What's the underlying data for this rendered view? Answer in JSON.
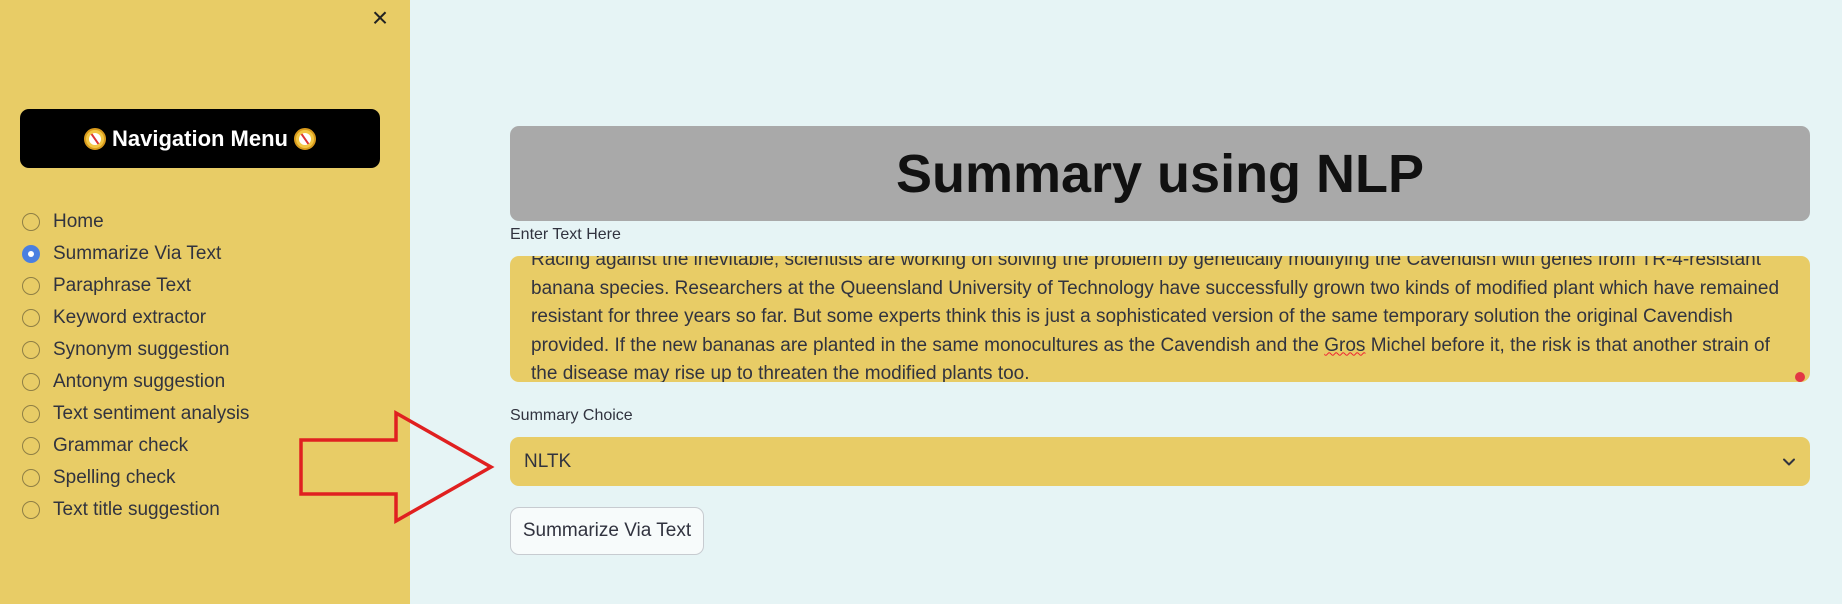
{
  "sidebar": {
    "close_icon": "×",
    "nav_title": "Navigation Menu",
    "items": [
      {
        "label": "Home",
        "selected": false
      },
      {
        "label": "Summarize Via Text",
        "selected": true
      },
      {
        "label": "Paraphrase Text",
        "selected": false
      },
      {
        "label": "Keyword extractor",
        "selected": false
      },
      {
        "label": "Synonym suggestion",
        "selected": false
      },
      {
        "label": "Antonym suggestion",
        "selected": false
      },
      {
        "label": "Text sentiment analysis",
        "selected": false
      },
      {
        "label": "Grammar check",
        "selected": false
      },
      {
        "label": "Spelling check",
        "selected": false
      },
      {
        "label": "Text title suggestion",
        "selected": false
      }
    ]
  },
  "main": {
    "title": "Summary using NLP",
    "text_label": "Enter Text Here",
    "text_value_before": "Racing against the inevitable, scientists are working on solving the problem by genetically modifying the Cavendish with genes from TR-4-resistant banana species. Researchers at the Queensland University of Technology have successfully grown two kinds of modified plant which have remained resistant for three years so far. But some experts think this is just a sophisticated version of the same temporary solution the original Cavendish provided. If the new bananas are planted in the same monocultures as the Cavendish and the ",
    "text_value_misspelled": "Gros",
    "text_value_after": " Michel before it, the risk is that another strain of the disease may rise up to threaten the modified plants too.",
    "choice_label": "Summary Choice",
    "choice_value": "NLTK",
    "button_label": "Summarize Via Text"
  },
  "colors": {
    "sidebar_bg": "#e8cc66",
    "main_bg": "#e6f4f5",
    "title_bg": "#a9a9a9",
    "radio_selected": "#4a7fe0",
    "annotation_arrow": "#e02020"
  },
  "icons": {
    "close": "close-icon",
    "compass": "compass-icon",
    "dropdown": "chevron-down-icon",
    "annotation": "arrow-right-icon"
  }
}
